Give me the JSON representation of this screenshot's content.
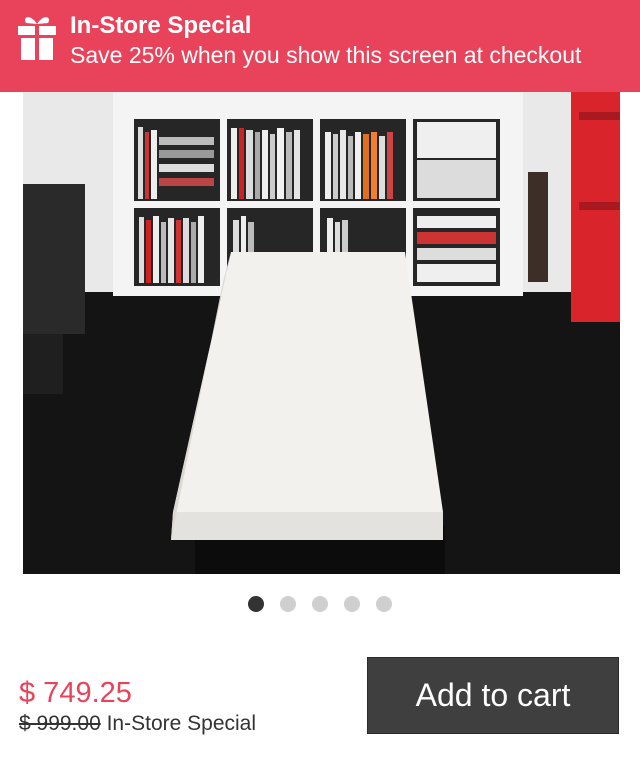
{
  "banner": {
    "title": "In-Store Special",
    "subtitle": "Save 25% when you show this screen at checkout",
    "background_color": "#e8435a",
    "icon": "gift-icon"
  },
  "product": {
    "image_description": "White low coffee table in front of bookshelf",
    "carousel": {
      "total": 5,
      "active_index": 0
    }
  },
  "pricing": {
    "sale_price": "$ 749.25",
    "original_price": "$ 999.00",
    "original_price_suffix": "In-Store Special",
    "accent_color": "#e8435a"
  },
  "actions": {
    "add_to_cart_label": "Add to cart"
  }
}
